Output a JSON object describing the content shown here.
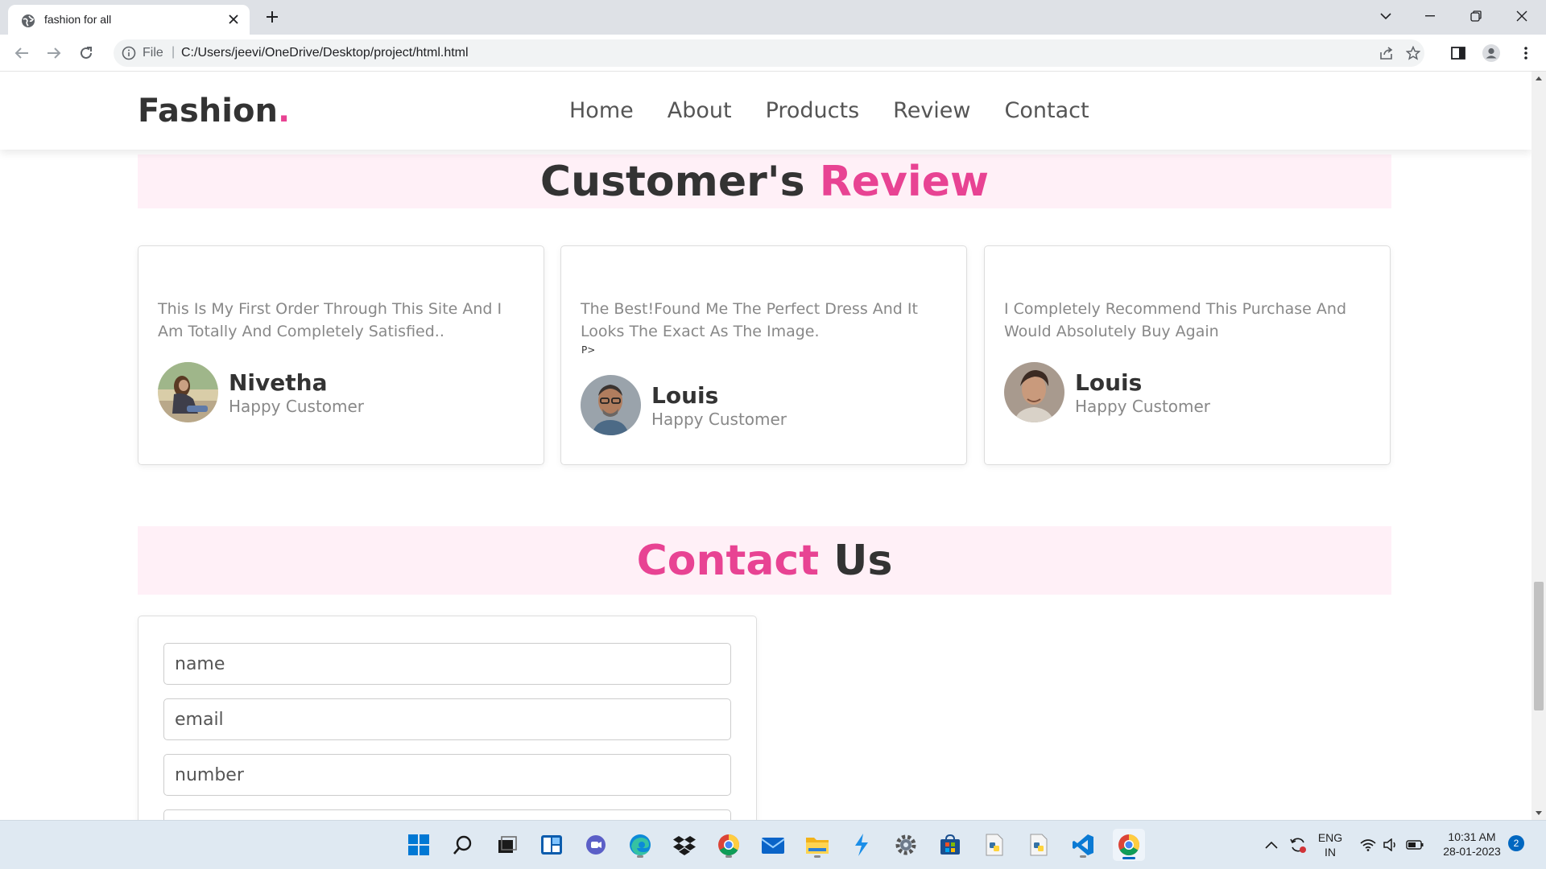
{
  "browser": {
    "tab_title": "fashion for all",
    "address_scheme": "File",
    "address_separator": "|",
    "address_url": "C:/Users/jeevi/OneDrive/Desktop/project/html.html"
  },
  "site": {
    "logo_text": "Fashion",
    "logo_dot": ".",
    "nav": [
      "Home",
      "About",
      "Products",
      "Review",
      "Contact"
    ],
    "accent_color": "#e84393"
  },
  "review_section": {
    "title_main": "Customer's",
    "title_accent": "Review",
    "cards": [
      {
        "text": "This Is My First Order Through This Site And I Am Totally And Completely Satisfied..",
        "name": "Nivetha",
        "role": "Happy Customer"
      },
      {
        "text": "The Best!Found Me The Perfect Dress And It Looks The Exact As The Image.",
        "stray": "P>",
        "name": "Louis",
        "role": "Happy Customer"
      },
      {
        "text": "I Completely Recommend This Purchase And Would Absolutely Buy Again",
        "name": "Louis",
        "role": "Happy Customer"
      }
    ]
  },
  "contact_section": {
    "title_accent": "Contact",
    "title_main": "Us",
    "placeholders": {
      "name": "name",
      "email": "email",
      "number": "number"
    }
  },
  "taskbar": {
    "icons": [
      "windows-start",
      "search",
      "task-view",
      "widgets",
      "teams-chat",
      "edge",
      "dropbox",
      "chrome",
      "mail",
      "file-explorer",
      "vscode-insiders",
      "settings",
      "store",
      "python-file",
      "python-file-2",
      "vscode",
      "chrome-active"
    ],
    "language_line1": "ENG",
    "language_line2": "IN",
    "time": "10:31 AM",
    "date": "28-01-2023",
    "notification_count": "2"
  }
}
